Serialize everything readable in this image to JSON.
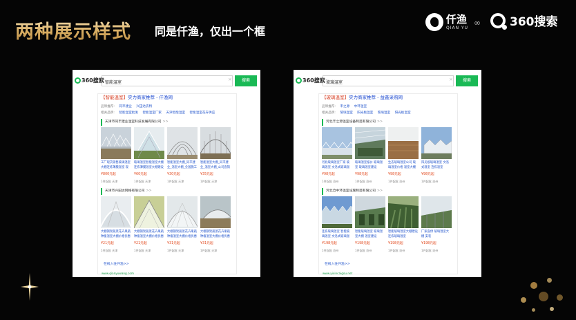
{
  "slide": {
    "title": "两种展示样式",
    "subtitle": "同是仟渔，仅出一个框",
    "logo_qianyu_cn": "仟渔",
    "logo_qianyu_en": "QIAN YU",
    "logo_360": "360搜索",
    "link_icon": "link-icon",
    "colors": {
      "title_gold": "#e3bd74",
      "background": "#050505",
      "search_green": "#19b955"
    }
  },
  "left": {
    "logo": "360搜索",
    "query": "智能温室",
    "search_button": "搜索",
    "title_highlight": "【智能温室】",
    "title_rest": "实力商家推荐 - 仟渔网",
    "brand_label": "品牌推荐:",
    "brands": [
      "同丰建业",
      "兴田达农特"
    ],
    "related_label": "相关品牌:",
    "related": [
      "智能温室批发",
      "智能温室厂家",
      "天津智能温室",
      "智能温室花卉供应"
    ],
    "sections": [
      {
        "company": "天津市同丰建业温室科技发展有限公司",
        "more": ">>",
        "items": [
          {
            "name": "工厂现货销售玻璃温室大棚连栋薄膜温室 现货出售",
            "price": "¥800元起",
            "meta": "1件起批  天津"
          },
          {
            "name": "玻璃温室智能温室大棚连栋薄膜温室大棚建设",
            "price": "¥60元起",
            "meta": "1件起批  天津"
          },
          {
            "name": "智能温室大棚_同丰建业_温室大棚_全国施工",
            "price": "¥30元起",
            "meta": "1件起批  天津"
          },
          {
            "name": "智能温室大棚_同丰建业_温室大棚_公司直销",
            "price": "¥35元起",
            "meta": "1件起批  天津"
          }
        ]
      },
      {
        "company": "天津市兴田达网格有限公司",
        "more": ">>",
        "items": [
          {
            "name": "大棚钢架蔬菜花卉果蔬种植温室大棚价格优惠",
            "price": "¥21元起",
            "meta": "1件起批  天津"
          },
          {
            "name": "大棚钢架蔬菜花卉果蔬种植温室大棚价格优惠",
            "price": "¥21元起",
            "meta": "1件起批  天津"
          },
          {
            "name": "大棚钢架蔬菜花卉果蔬种植温室大棚价格优惠",
            "price": "¥31元起",
            "meta": "1件起批  天津"
          },
          {
            "name": "大棚钢架蔬菜花卉果蔬种植温室大棚价格优惠",
            "price": "¥31元起",
            "meta": "1件起批  天津"
          }
        ]
      }
    ],
    "more_link": "在线入驻仟渔>>",
    "site": "www.qianyuwang.com"
  },
  "right": {
    "logo": "360搜索",
    "query": "玻璃温室",
    "search_button": "搜索",
    "title_highlight": "【玻璃温室】",
    "title_rest": "实力商家推荐 - 益鑫采购网",
    "brand_label": "品牌推荐:",
    "brands": [
      "丰之源",
      "中环温室"
    ],
    "related_label": "相关品牌:",
    "related": [
      "玻璃温室",
      "阳光板温室",
      "玻璃温室",
      "阳光板温室"
    ],
    "sections": [
      {
        "company": "河北丰之源温室设备制造有限公司",
        "more": ">>",
        "items": [
          {
            "name": "河北玻璃温室厂家 玻璃温室 文洛式玻璃温室",
            "price": "¥98元起",
            "meta": "1件起批  沧州"
          },
          {
            "name": "玻璃温室报价 玻璃温室 玻璃温室建设",
            "price": "¥98元起",
            "meta": "1件起批  沧州"
          },
          {
            "name": "生态玻璃温室公司 玻璃温室价格 温室大棚",
            "price": "¥98元起",
            "meta": "1件起批  沧州"
          },
          {
            "name": "阳光板玻璃温室 文洛式温室 连栋温室",
            "price": "¥98元起",
            "meta": "1件起批  沧州"
          }
        ]
      },
      {
        "company": "河北沧中环温室设施制造有限公司",
        "more": ">>",
        "items": [
          {
            "name": "连栋玻璃温室 智能玻璃温室 文洛式玻璃温室",
            "price": "¥198元起",
            "meta": "1件起批  沧州"
          },
          {
            "name": "智能玻璃温室 玻璃温室大棚 温室建设",
            "price": "¥198元起",
            "meta": "1件起批  沧州"
          },
          {
            "name": "智能玻璃温室大棚建设 连栋玻璃温室",
            "price": "¥198元起",
            "meta": "1件起批  沧州"
          },
          {
            "name": "厂家直供 玻璃温室大棚 安装",
            "price": "¥198元起",
            "meta": "1件起批  沧州"
          }
        ]
      }
    ],
    "more_link": "在线入驻仟渔>>",
    "site": "www.yixincaigou.net"
  }
}
